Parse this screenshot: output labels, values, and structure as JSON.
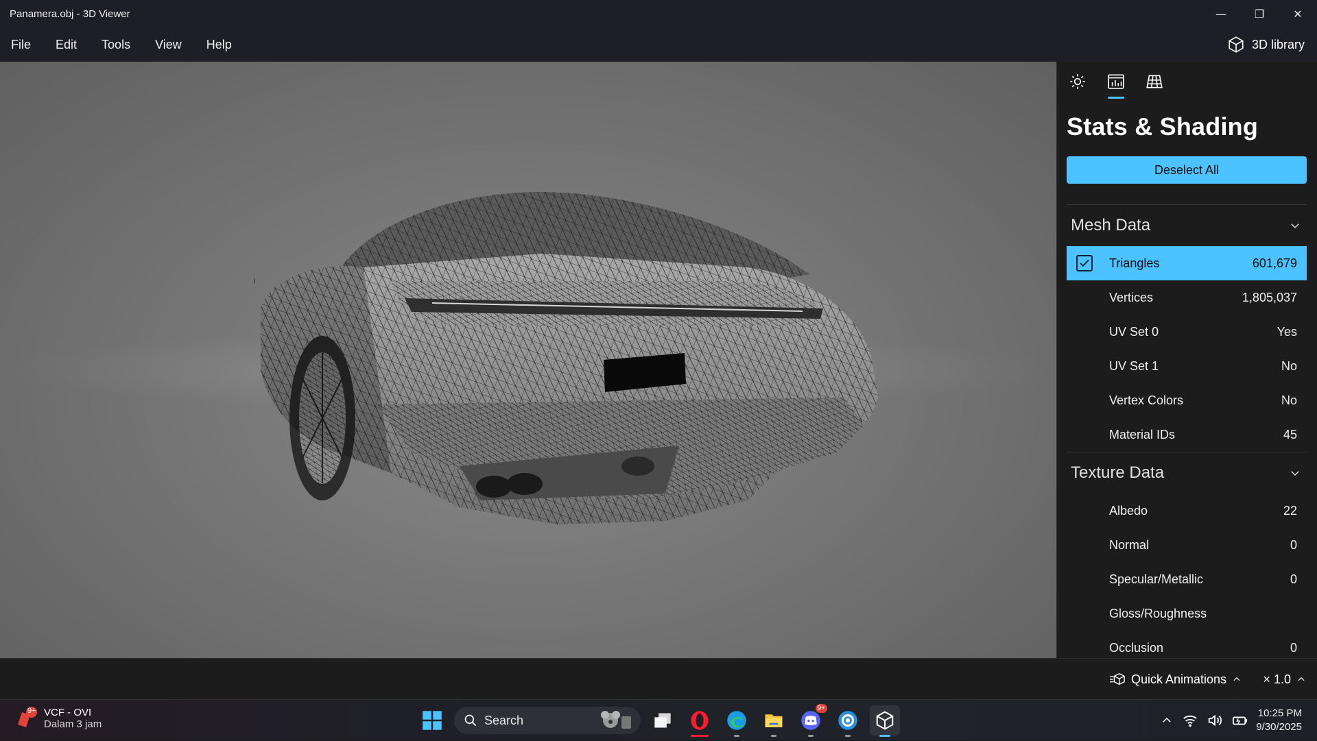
{
  "window": {
    "title": "Panamera.obj - 3D Viewer"
  },
  "menu": {
    "items": [
      "File",
      "Edit",
      "Tools",
      "View",
      "Help"
    ],
    "library_label": "3D library"
  },
  "panel": {
    "title": "Stats & Shading",
    "deselect_label": "Deselect All",
    "mesh_section": "Mesh Data",
    "mesh_rows": [
      {
        "label": "Triangles",
        "value": "601,679"
      },
      {
        "label": "Vertices",
        "value": "1,805,037"
      },
      {
        "label": "UV Set 0",
        "value": "Yes"
      },
      {
        "label": "UV Set 1",
        "value": "No"
      },
      {
        "label": "Vertex Colors",
        "value": "No"
      },
      {
        "label": "Material IDs",
        "value": "45"
      }
    ],
    "texture_section": "Texture Data",
    "texture_rows": [
      {
        "label": "Albedo",
        "value": "22"
      },
      {
        "label": "Normal",
        "value": "0"
      },
      {
        "label": "Specular/Metallic",
        "value": "0"
      },
      {
        "label": "Gloss/Roughness",
        "value": ""
      },
      {
        "label": "Occlusion",
        "value": "0"
      }
    ]
  },
  "bottombar": {
    "quick_animations": "Quick Animations",
    "speed": "× 1.0"
  },
  "taskbar": {
    "notification_title": "VCF - OVI",
    "notification_sub": "Dalam 3 jam",
    "notification_badge": "9+",
    "search_label": "Search",
    "discord_badge": "9+",
    "time": "10:25 PM",
    "date": "9/30/2025"
  },
  "colors": {
    "accent": "#4cc2ff",
    "panel_bg": "#1c1c1c",
    "titlebar_bg": "#1e1e26"
  }
}
